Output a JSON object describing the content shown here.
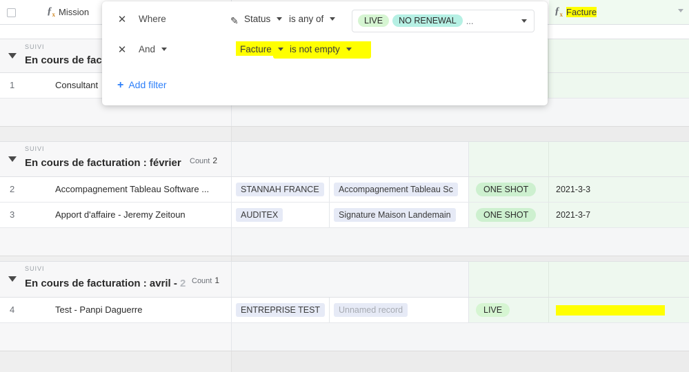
{
  "header": {
    "checkbox_name": "select-all",
    "columns": [
      {
        "label": "Mission",
        "icon": "formula-icon",
        "highlight": false,
        "tinted": false
      },
      {
        "label": "Facture",
        "icon": "formula-icon",
        "highlight": true,
        "tinted": true
      }
    ]
  },
  "filter_panel": {
    "rows": [
      {
        "conjunction": "Where",
        "has_conj_caret": false,
        "field": "Status",
        "field_icon": "pencil-icon",
        "operator": "is any of",
        "highlighted": false,
        "value_chips": [
          {
            "label": "LIVE",
            "color": "#d6f5d2"
          },
          {
            "label": "NO RENEWAL",
            "color": "#b6f0e4"
          }
        ],
        "value_overflow": "..."
      },
      {
        "conjunction": "And",
        "has_conj_caret": true,
        "field": "Facture",
        "field_icon": "",
        "operator": "is not empty",
        "highlighted": true,
        "value_chips": [],
        "value_overflow": ""
      }
    ],
    "add_filter_label": "Add filter",
    "add_filter_plus": "+"
  },
  "groups": [
    {
      "field_label": "SUIVI",
      "title": "En cours de fact",
      "title_dim": "",
      "count_label": "",
      "count_value": "",
      "collapsed": false
    },
    {
      "field_label": "SUIVI",
      "title": "En cours de facturation : février",
      "title_dim": "",
      "count_label": "Count",
      "count_value": "2",
      "collapsed": false
    },
    {
      "field_label": "SUIVI",
      "title": "En cours de facturation : avril - ",
      "title_dim": "2",
      "count_label": "Count",
      "count_value": "1",
      "collapsed": false
    }
  ],
  "rows": [
    {
      "index": "1",
      "mission": "Consultant",
      "client": "",
      "detail": "",
      "status": "",
      "status_color": "",
      "facture": "",
      "redacted": false,
      "detail_empty": false
    },
    {
      "index": "2",
      "mission": "Accompagnement Tableau Software ...",
      "client": "STANNAH FRANCE",
      "detail": "Accompagnement Tableau Sc",
      "status": "ONE SHOT",
      "status_color": "#cdf0cf",
      "facture": "2021-3-3",
      "redacted": false,
      "detail_empty": false
    },
    {
      "index": "3",
      "mission": "Apport d'affaire - Jeremy Zeitoun",
      "client": "AUDITEX",
      "detail": "Signature Maison Landemain",
      "status": "ONE SHOT",
      "status_color": "#cdf0cf",
      "facture": "2021-3-7",
      "redacted": false,
      "detail_empty": false
    },
    {
      "index": "4",
      "mission": "Test - Panpi Daguerre",
      "client": "ENTREPRISE TEST",
      "detail": "Unnamed record",
      "status": "LIVE",
      "status_color": "#d6f5d2",
      "facture": "",
      "redacted": true,
      "detail_empty": true
    }
  ],
  "colors": {
    "highlight_yellow": "#ffff00",
    "link_chip": "#e6eaf6",
    "tinted_column": "#eef8ef",
    "accent_blue": "#2d7ff9"
  }
}
